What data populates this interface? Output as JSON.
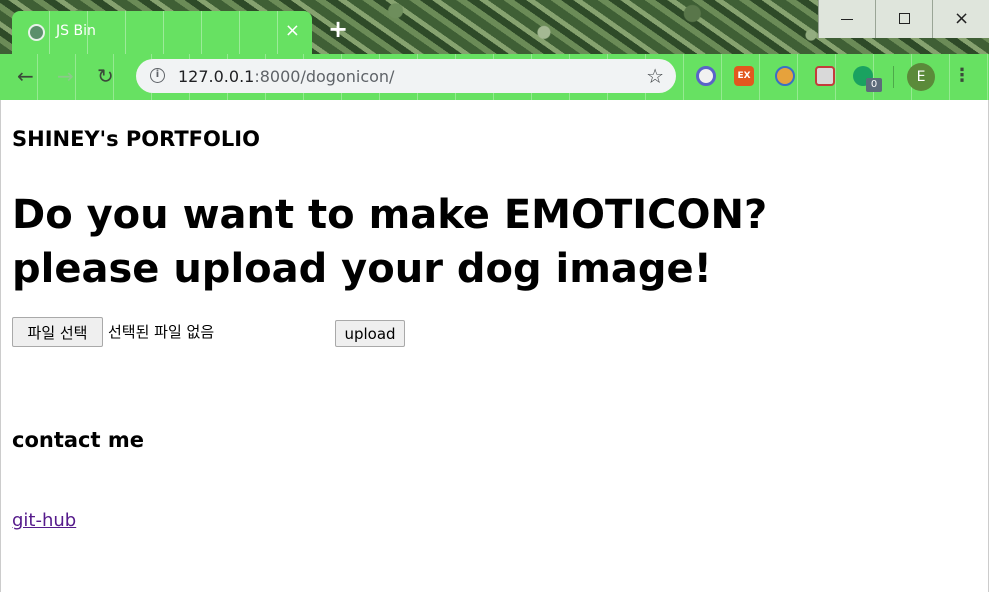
{
  "browser": {
    "tab": {
      "title": "JS Bin",
      "close_glyph": "×"
    },
    "new_tab_glyph": "+",
    "window_controls": {
      "minimize": "minimize-icon",
      "maximize": "maximize-icon",
      "close": "×"
    },
    "nav": {
      "back": "←",
      "forward": "→",
      "reload": "↻"
    },
    "address": {
      "host": "127.0.0.1",
      "path": ":8000/dogonicon/",
      "info_glyph": "i",
      "star_glyph": "☆"
    },
    "extensions": {
      "ex_label": "EX",
      "badge_count": "0"
    },
    "profile_initial": "E",
    "menu_glyph": "⋮",
    "colors": {
      "theme": "#67e162",
      "omnibox": "#f1f3f4"
    }
  },
  "page": {
    "site_title": "SHINEY's PORTFOLIO",
    "headline_line1": "Do you want to make EMOTICON?",
    "headline_line2": "please upload your dog image!",
    "form": {
      "file_button_label": "파일 선택",
      "file_status": "선택된 파일 없음",
      "upload_label": "upload"
    },
    "contact_heading": "contact me",
    "github_link": "git-hub",
    "colors": {
      "link": "#551a8b"
    }
  }
}
